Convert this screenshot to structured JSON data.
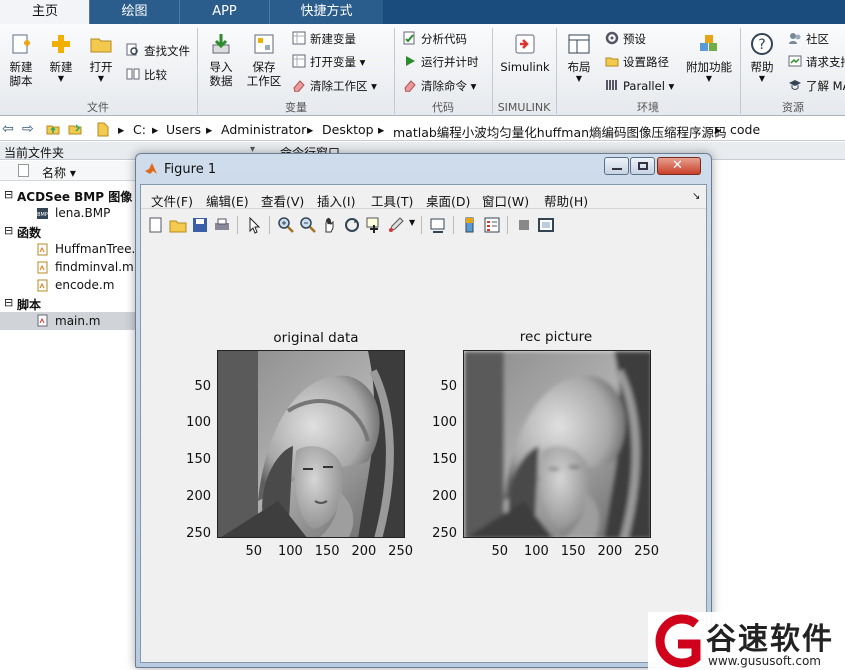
{
  "tabs": [
    {
      "label": "主页",
      "active": true
    },
    {
      "label": "绘图"
    },
    {
      "label": "APP"
    },
    {
      "label": "快捷方式"
    }
  ],
  "ribbon": {
    "groups": [
      "文件",
      "变量",
      "代码",
      "SIMULINK",
      "环境",
      "资源"
    ],
    "file": {
      "new_script": [
        "新建",
        "脚本"
      ],
      "new": "新建",
      "open": "打开",
      "find_files": "查找文件",
      "compare": "比较"
    },
    "variable": {
      "import": [
        "导入",
        "数据"
      ],
      "save_ws": [
        "保存",
        "工作区"
      ],
      "new_var": "新建变量",
      "open_var": "打开变量",
      "clear_ws": "清除工作区"
    },
    "code": {
      "analyze": "分析代码",
      "run_time": "运行并计时",
      "clear_cmd": "清除命令"
    },
    "simulink": {
      "label": "Simulink"
    },
    "env": {
      "layout": "布局",
      "prefs": "预设",
      "set_path": "设置路径",
      "parallel": "Parallel",
      "addons": "附加功能"
    },
    "resources": {
      "help": "帮助",
      "community": "社区",
      "request_support": "请求支持",
      "learn": "了解 MA"
    }
  },
  "address": {
    "path": [
      "C:",
      "Users",
      "Administrator",
      "Desktop",
      "matlab编程小波均匀量化huffman熵编码图像压缩程序源码",
      "code"
    ]
  },
  "panel": {
    "current_folder": "当前文件夹",
    "command_window": "命令行窗口",
    "name_column": "名称"
  },
  "tree": [
    {
      "label": "ACDSee BMP 图像",
      "bold": true
    },
    {
      "label": "lena.BMP"
    },
    {
      "label": "函数",
      "bold": true
    },
    {
      "label": "HuffmanTree.m"
    },
    {
      "label": "findminval.m"
    },
    {
      "label": "encode.m"
    },
    {
      "label": "脚本",
      "bold": true
    },
    {
      "label": "main.m"
    }
  ],
  "figure": {
    "title": "Figure 1",
    "menu": [
      "文件(F)",
      "编辑(E)",
      "查看(V)",
      "插入(I)",
      "工具(T)",
      "桌面(D)",
      "窗口(W)",
      "帮助(H)"
    ],
    "plots": [
      {
        "title": "original data",
        "yticks": [
          "50",
          "100",
          "150",
          "200",
          "250"
        ],
        "xticks": [
          "50",
          "100",
          "150",
          "200",
          "250"
        ]
      },
      {
        "title": "rec picture",
        "yticks": [
          "50",
          "100",
          "150",
          "200",
          "250"
        ],
        "xticks": [
          "50",
          "100",
          "150",
          "200",
          "250"
        ]
      }
    ]
  },
  "watermark": {
    "brand": "谷速软件",
    "url": "www.gususoft.com"
  }
}
